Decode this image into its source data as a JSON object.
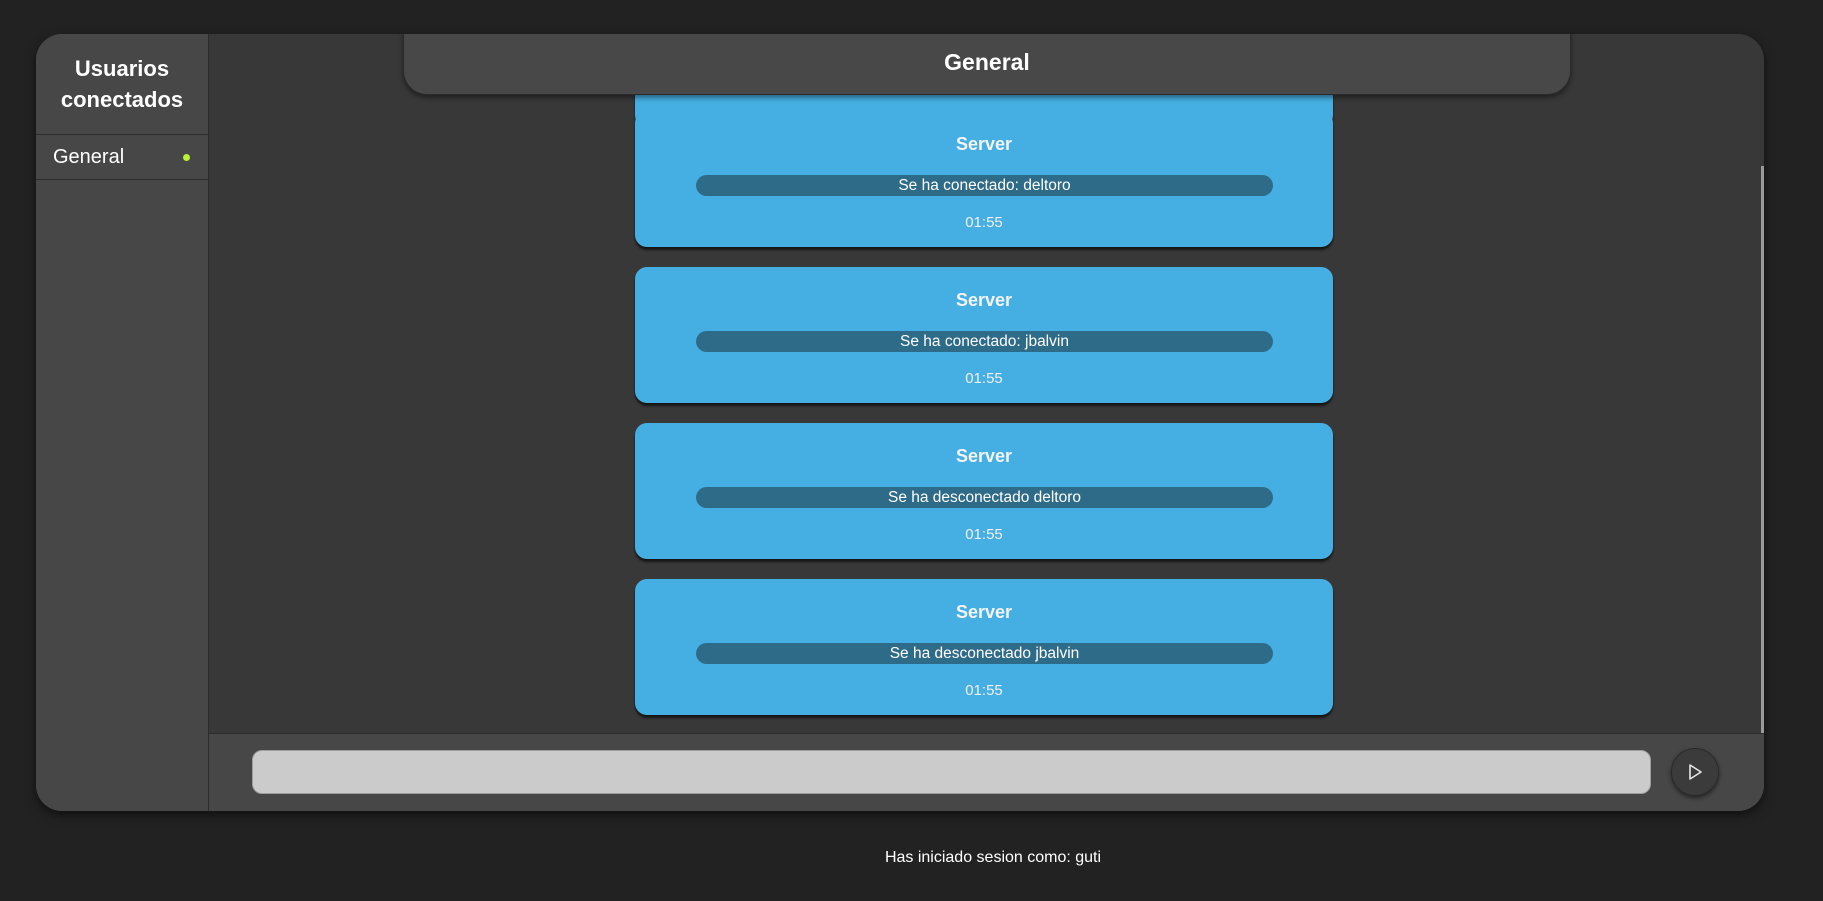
{
  "sidebar": {
    "title": "Usuarios conectados",
    "rooms": [
      {
        "label": "General",
        "status_color": "#b8f03a"
      }
    ]
  },
  "chat": {
    "title": "General",
    "messages": [
      {
        "author": "Server",
        "text": "Se ha conectado: deltoro",
        "time": "01:55"
      },
      {
        "author": "Server",
        "text": "Se ha conectado: jbalvin",
        "time": "01:55"
      },
      {
        "author": "Server",
        "text": "Se ha desconectado deltoro",
        "time": "01:55"
      },
      {
        "author": "Server",
        "text": "Se ha desconectado jbalvin",
        "time": "01:55"
      }
    ]
  },
  "composer": {
    "placeholder": "",
    "send_icon": "send-triangle-icon"
  },
  "footer": {
    "login_status": "Has iniciado sesion como: guti"
  },
  "colors": {
    "background": "#222222",
    "panel": "#383838",
    "sidebar": "#474747",
    "message_card": "#45aee2",
    "message_text_bar": "#2e6b89",
    "online_dot": "#b8f03a"
  }
}
